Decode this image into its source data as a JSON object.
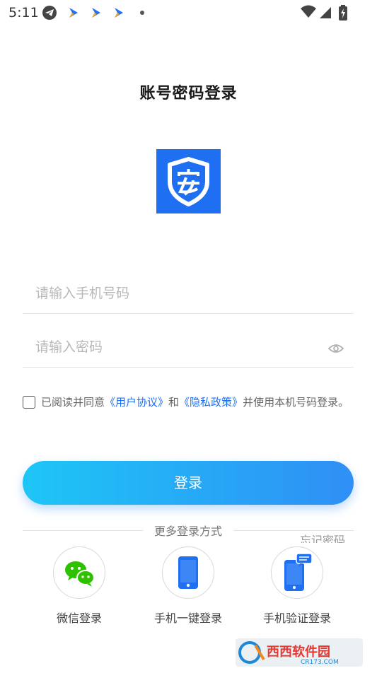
{
  "status_bar": {
    "time": "5:11"
  },
  "page": {
    "title": "账号密码登录"
  },
  "form": {
    "phone_placeholder": "请输入手机号码",
    "password_placeholder": "请输入密码"
  },
  "agreement": {
    "prefix": "已阅读并同意",
    "user_agreement": "《用户协议》",
    "and": "和",
    "privacy_policy": "《隐私政策》",
    "suffix": "并使用本机号码登录。"
  },
  "login_button": "登录",
  "more_login": "更多登录方式",
  "forgot_password": "忘记密码",
  "methods": [
    {
      "label": "微信登录",
      "icon": "wechat-icon"
    },
    {
      "label": "手机一键登录",
      "icon": "phone-icon"
    },
    {
      "label": "手机验证登录",
      "icon": "phone-message-icon"
    }
  ],
  "watermark": {
    "main": "西西软件园",
    "sub": "CR173.COM"
  },
  "colors": {
    "brand_blue": "#1f6ff2",
    "button_start": "#1ec6f6",
    "button_end": "#2f8ff5",
    "wechat_green": "#2dc100"
  }
}
